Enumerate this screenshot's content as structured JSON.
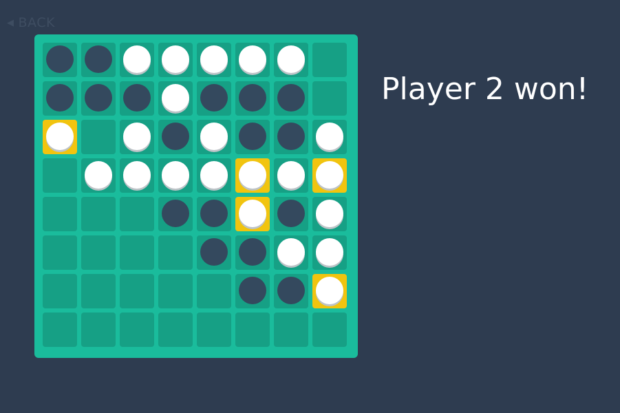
{
  "nav": {
    "back_label": "BACK",
    "back_icon": "left-triangle-icon"
  },
  "status": {
    "message": "Player 2 won!"
  },
  "colors": {
    "background": "#2e3c50",
    "board": "#1abc9c",
    "cell": "#16a085",
    "highlight": "#f1c40f",
    "dark_disc": "#34495e",
    "light_disc": "#ffffff"
  },
  "board": {
    "size": 8,
    "legend": {
      "D": "dark disc (player 1)",
      "W": "white disc (player 2)",
      ".": "empty"
    },
    "rows": [
      [
        "D",
        "D",
        "W",
        "W",
        "W",
        "W",
        "W",
        "."
      ],
      [
        "D",
        "D",
        "D",
        "W",
        "D",
        "D",
        "D",
        "."
      ],
      [
        "W",
        ".",
        "W",
        "D",
        "W",
        "D",
        "D",
        "W"
      ],
      [
        ".",
        "W",
        "W",
        "W",
        "W",
        "W",
        "W",
        "W"
      ],
      [
        ".",
        ".",
        ".",
        "D",
        "D",
        "W",
        "D",
        "W"
      ],
      [
        ".",
        ".",
        ".",
        ".",
        "D",
        "D",
        "W",
        "W"
      ],
      [
        ".",
        ".",
        ".",
        ".",
        ".",
        "D",
        "D",
        "W"
      ],
      [
        ".",
        ".",
        ".",
        ".",
        ".",
        ".",
        ".",
        "."
      ]
    ],
    "highlighted": [
      [
        2,
        0
      ],
      [
        3,
        5
      ],
      [
        3,
        7
      ],
      [
        4,
        5
      ],
      [
        6,
        7
      ]
    ]
  }
}
